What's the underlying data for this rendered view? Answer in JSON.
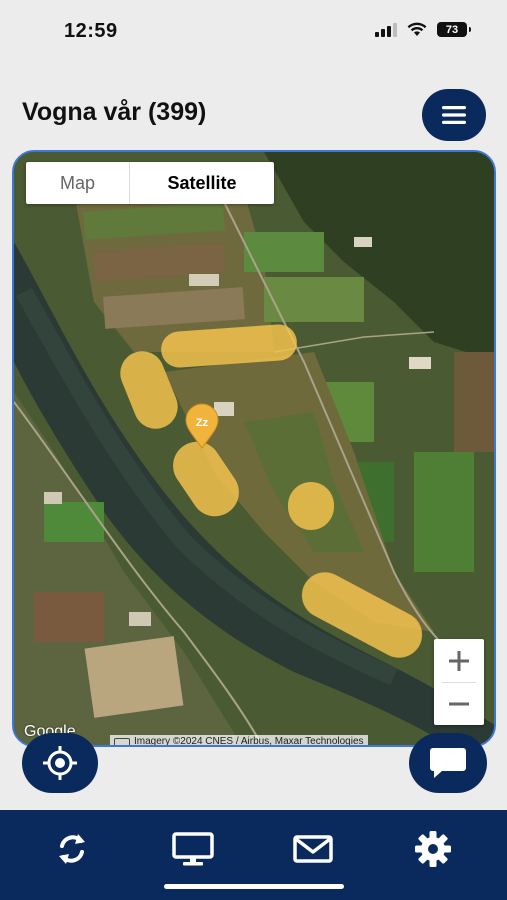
{
  "status_bar": {
    "time": "12:59",
    "battery": "73",
    "icons": [
      "cellular-signal-icon",
      "wifi-icon",
      "battery-icon"
    ]
  },
  "header": {
    "title": "Vogna vår (399)",
    "menu_icon": "hamburger-menu-icon"
  },
  "map": {
    "type_toggle": {
      "options": [
        "Map",
        "Satellite"
      ],
      "selected": "Satellite"
    },
    "zoom_in_label": "+",
    "zoom_out_label": "−",
    "provider_logo": "Google",
    "attribution": "Imagery ©2024 CNES / Airbus, Maxar Technologies",
    "marker_label": "Zz",
    "marker_icon": "sleeping-animal-marker-icon",
    "colors": {
      "track": "#f2c24f",
      "marker": "#f0b43c"
    }
  },
  "actions": {
    "locate_icon": "crosshair-locate-icon",
    "chat_icon": "chat-bubble-icon"
  },
  "bottom_nav": {
    "items": [
      {
        "icon": "refresh-icon"
      },
      {
        "icon": "monitor-icon"
      },
      {
        "icon": "mail-icon"
      },
      {
        "icon": "settings-gear-icon"
      }
    ]
  },
  "colors": {
    "brand_navy": "#0a2a5e",
    "map_border": "#3d78d8",
    "background": "#ececec"
  }
}
